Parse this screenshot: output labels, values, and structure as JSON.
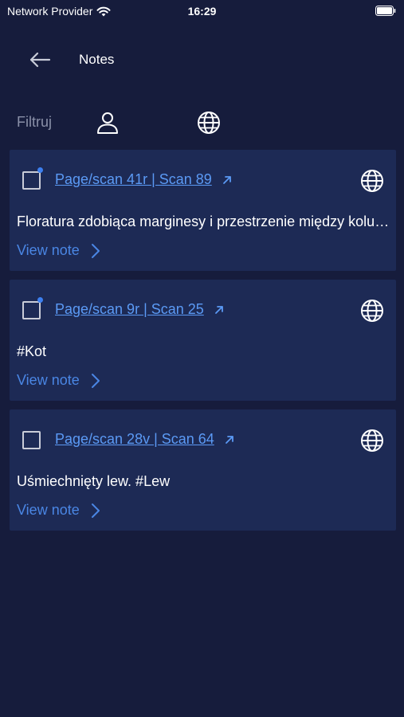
{
  "status": {
    "carrier": "Network Provider",
    "time": "16:29"
  },
  "header": {
    "title": "Notes"
  },
  "filter": {
    "label": "Filtruj"
  },
  "notes": [
    {
      "link": "Page/scan 41r | Scan 89",
      "text": "Floratura zdobiąca marginesy i przestrzenie między kolumnami",
      "view_label": "View note"
    },
    {
      "link": "Page/scan 9r | Scan 25",
      "text": "#Kot",
      "view_label": "View note"
    },
    {
      "link": "Page/scan 28v | Scan 64",
      "text": "Uśmiechnięty lew. #Lew",
      "view_label": "View note"
    }
  ],
  "icons": {
    "back": "arrow-left-icon",
    "user": "user-icon",
    "globe": "globe-icon",
    "external": "arrow-up-right-icon",
    "chevron": "chevron-right-icon",
    "wifi": "wifi-icon",
    "battery": "battery-icon"
  },
  "colors": {
    "background": "#161c3c",
    "card": "#1d2a55",
    "link": "#5b9af5",
    "accent": "#4a86e4",
    "muted": "#8a90a8"
  }
}
